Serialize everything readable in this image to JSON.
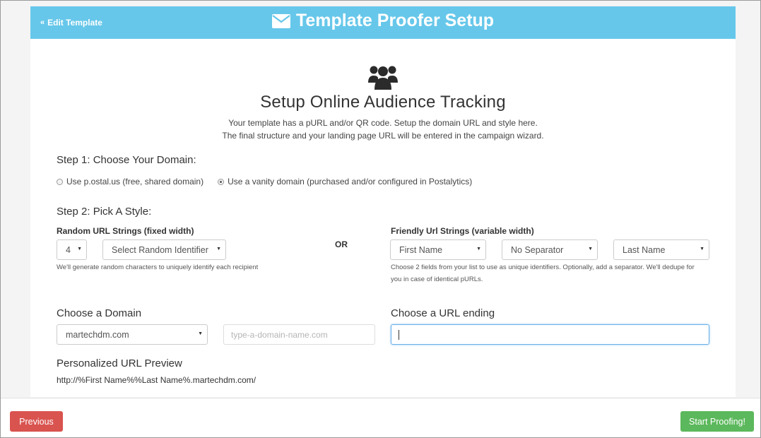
{
  "header": {
    "back_label": "Edit Template",
    "title": "Template Proofer Setup",
    "bg_color": "#66c7ea"
  },
  "icons": {
    "back": "double-chevron-left-icon",
    "title": "envelope-icon",
    "hero": "users-group-icon"
  },
  "intro": {
    "title": "Setup Online Audience Tracking",
    "line1": "Your template has a pURL and/or QR code. Setup the domain URL and style here.",
    "line2": "The final structure and your landing page URL will be entered in the campaign wizard."
  },
  "step1": {
    "title": "Step 1: Choose Your Domain:",
    "options": [
      {
        "label": "Use p.ostal.us (free, shared domain)",
        "selected": false
      },
      {
        "label": "Use a vanity domain (purchased and/or configured in Postalytics)",
        "selected": true
      }
    ]
  },
  "step2": {
    "title": "Step 2: Pick A Style:",
    "random": {
      "label": "Random URL Strings (fixed width)",
      "length_value": "4",
      "identifier_value": "Select Random Identifier",
      "help": "We'll generate random characters to uniquely identify each recipient"
    },
    "or_label": "OR",
    "friendly": {
      "label": "Friendly Url Strings (variable width)",
      "field1_value": "First Name",
      "separator_value": "No Separator",
      "field2_value": "Last Name",
      "help_line1": "Choose 2 fields from your list to use as unique identifiers. Optionally, add a separator. We'll dedupe for",
      "help_line2": "you in case of identical pURLs."
    }
  },
  "domain": {
    "title": "Choose a Domain",
    "selected": "martechdm.com",
    "custom_placeholder": "type-a-domain-name.com"
  },
  "ending": {
    "title": "Choose a URL ending",
    "value": ""
  },
  "preview": {
    "title": "Personalized URL Preview",
    "url": "http://%First Name%%Last Name%.martechdm.com/"
  },
  "footer": {
    "previous_label": "Previous",
    "start_label": "Start Proofing!",
    "previous_color": "#d9534f",
    "start_color": "#5cb85c"
  }
}
